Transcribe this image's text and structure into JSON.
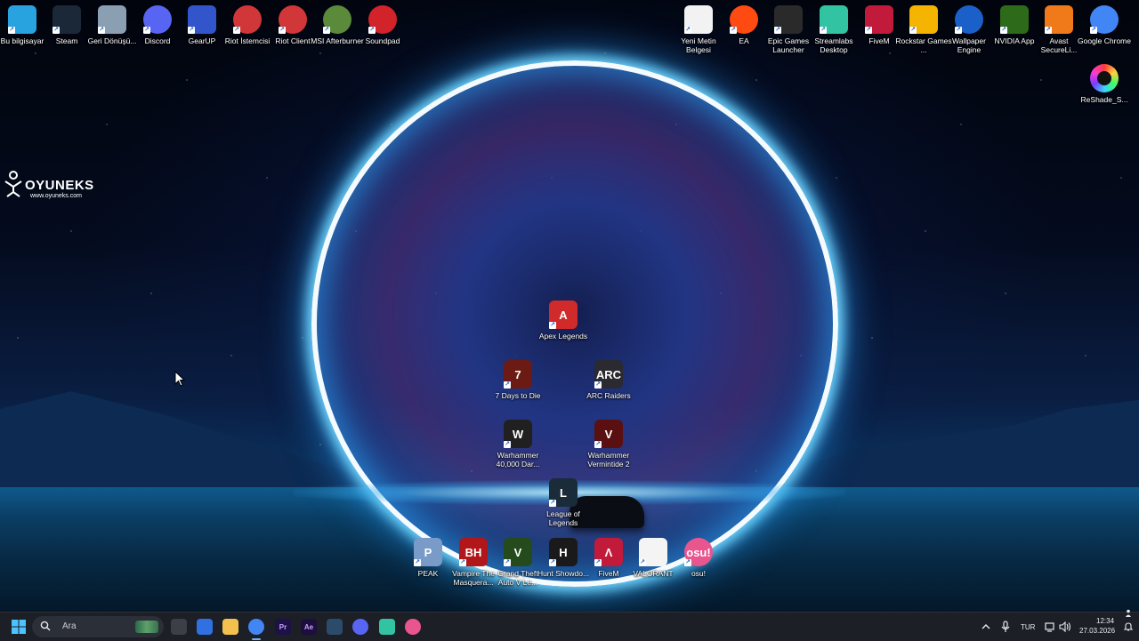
{
  "desktop": {
    "brand_logo": {
      "name": "OYUNEKS",
      "url": "www.oyuneks.com"
    },
    "top_left_icons": [
      {
        "label": "Bu bilgisayar",
        "icon": "computer-icon",
        "color": "#29a3e0"
      },
      {
        "label": "Steam",
        "icon": "steam-icon",
        "color": "#1b2838"
      },
      {
        "label": "Geri Dönüşü...",
        "icon": "recycle-bin-icon",
        "color": "#8aa0b2"
      },
      {
        "label": "Discord",
        "icon": "discord-icon",
        "color": "#5865f2"
      },
      {
        "label": "GearUP",
        "icon": "gearup-icon",
        "color": "#3355cc"
      },
      {
        "label": "Riot İstemcisi",
        "icon": "riot-icon",
        "color": "#d13639"
      },
      {
        "label": "Riot Client",
        "icon": "riot-icon",
        "color": "#d13639"
      },
      {
        "label": "MSI Afterburner",
        "icon": "afterburner-icon",
        "color": "#5a8a3a"
      },
      {
        "label": "Soundpad",
        "icon": "soundpad-icon",
        "color": "#d2222a"
      }
    ],
    "top_right_icons": [
      {
        "label": "Yeni Metin Belgesi",
        "icon": "text-document-icon",
        "color": "#f2f2f2"
      },
      {
        "label": "EA",
        "icon": "ea-icon",
        "color": "#ff4a12"
      },
      {
        "label": "Epic Games Launcher",
        "icon": "epic-games-icon",
        "color": "#2a2a2a"
      },
      {
        "label": "Streamlabs Desktop",
        "icon": "streamlabs-icon",
        "color": "#31c3a2"
      },
      {
        "label": "FiveM",
        "icon": "fivem-icon",
        "color": "#c21a3a"
      },
      {
        "label": "Rockstar Games ...",
        "icon": "rockstar-icon",
        "color": "#f4b400"
      },
      {
        "label": "Wallpaper Engine",
        "icon": "wallpaper-engine-icon",
        "color": "#1b5fc8"
      },
      {
        "label": "NVIDIA App",
        "icon": "nvidia-icon",
        "color": "#2d6a1a"
      },
      {
        "label": "Avast SecureLi...",
        "icon": "avast-vpn-icon",
        "color": "#f07a1a"
      },
      {
        "label": "Google Chrome",
        "icon": "chrome-icon",
        "color": "#4285f4"
      }
    ],
    "reshade": {
      "label": "ReShade_S...",
      "icon": "reshade-icon"
    },
    "game_icons": [
      {
        "label": "Apex Legends",
        "icon": "apex-legends-icon",
        "color": "#d12a2a",
        "text": "A"
      },
      {
        "label": "7 Days to Die",
        "icon": "7-days-to-die-icon",
        "color": "#6b1b14",
        "text": "7"
      },
      {
        "label": "ARC Raiders",
        "icon": "arc-raiders-icon",
        "color": "#2a2a30",
        "text": "ARC"
      },
      {
        "label": "Warhammer 40,000 Dar...",
        "icon": "warhammer-40k-icon",
        "color": "#202020",
        "text": "W"
      },
      {
        "label": "Warhammer Vermintide 2",
        "icon": "vermintide-icon",
        "color": "#5a1010",
        "text": "V"
      },
      {
        "label": "League of Legends",
        "icon": "league-of-legends-icon",
        "color": "#1a2b3a",
        "text": "L"
      }
    ],
    "bottom_icons": [
      {
        "label": "PEAK",
        "icon": "peak-icon",
        "color": "#7a9ac8",
        "text": "P"
      },
      {
        "label": "Vampire The Masquera...",
        "icon": "vampire-bloodhunt-icon",
        "color": "#b0161a",
        "text": "BH"
      },
      {
        "label": "Grand Theft Auto V Le...",
        "icon": "gta-v-icon",
        "color": "#254a1c",
        "text": "V"
      },
      {
        "label": "Hunt Showdo...",
        "icon": "hunt-showdown-icon",
        "color": "#1a1a1a",
        "text": "H"
      },
      {
        "label": "FiveM",
        "icon": "fivem-icon",
        "color": "#c21a3a",
        "text": "Λ"
      },
      {
        "label": "VALORANT",
        "icon": "valorant-icon",
        "color": "#f4f4f4",
        "text": ""
      },
      {
        "label": "osu!",
        "icon": "osu-icon",
        "color": "#e9558f",
        "text": "osu!"
      }
    ]
  },
  "taskbar": {
    "search_placeholder": "Ara",
    "pinned": [
      {
        "name": "task-view",
        "icon": "task-view-icon",
        "color": "#3a3f48"
      },
      {
        "name": "copilot",
        "icon": "copilot-icon",
        "color": "#3070e0"
      },
      {
        "name": "file-explorer",
        "icon": "folder-icon",
        "color": "#f2c14e"
      },
      {
        "name": "chrome",
        "icon": "chrome-icon",
        "color": "#4285f4"
      },
      {
        "name": "premiere-pro",
        "icon": "premiere-icon",
        "color": "#1d1147",
        "text": "Pr"
      },
      {
        "name": "after-effects",
        "icon": "after-effects-icon",
        "color": "#1c0f3d",
        "text": "Ae"
      },
      {
        "name": "gearup",
        "icon": "gearup-icon",
        "color": "#2c4a6a"
      },
      {
        "name": "discord",
        "icon": "discord-icon",
        "color": "#5865f2"
      },
      {
        "name": "streamlabs",
        "icon": "streamlabs-icon",
        "color": "#31c3a2"
      },
      {
        "name": "osu",
        "icon": "osu-icon",
        "color": "#e9558f"
      }
    ],
    "tray": {
      "language": "TUR",
      "time": "12:34",
      "date": "27.03.2026"
    }
  }
}
